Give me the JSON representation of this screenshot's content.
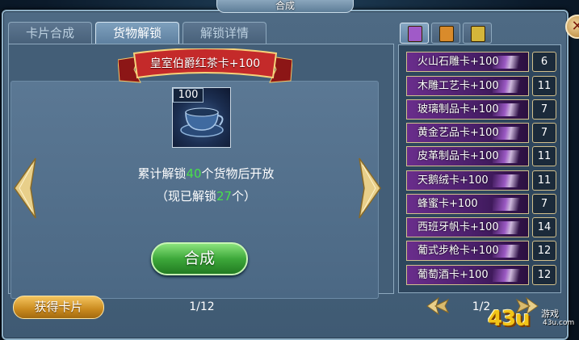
{
  "window": {
    "title": "合成"
  },
  "tabs": [
    {
      "label": "卡片合成",
      "active": false
    },
    {
      "label": "货物解锁",
      "active": true
    },
    {
      "label": "解锁详情",
      "active": false
    }
  ],
  "featured": {
    "name": "皇室伯爵红茶卡+100",
    "badge": "100",
    "unlock_prefix": "累计解锁",
    "unlock_target": "40",
    "unlock_suffix": "个货物后开放",
    "current_prefix": "（现已解锁",
    "current_value": "27",
    "current_suffix": "个）"
  },
  "buttons": {
    "craft": "合成",
    "get_card": "获得卡片"
  },
  "pagination_left": "1/12",
  "pagination_right": "1/2",
  "icon_tabs": [
    {
      "icon": "purple-book-icon",
      "color": "#a05ac8",
      "active": true
    },
    {
      "icon": "orange-book-icon",
      "color": "#d98b2b",
      "active": false
    },
    {
      "icon": "gold-book-icon",
      "color": "#d4b53a",
      "active": false
    }
  ],
  "card_list": [
    {
      "name": "火山石雕卡+100",
      "count": "6"
    },
    {
      "name": "木雕工艺卡+100",
      "count": "11"
    },
    {
      "name": "玻璃制品卡+100",
      "count": "7"
    },
    {
      "name": "黄金艺品卡+100",
      "count": "7"
    },
    {
      "name": "皮革制品卡+100",
      "count": "11"
    },
    {
      "name": "天鹅绒卡+100",
      "count": "11"
    },
    {
      "name": "蜂蜜卡+100",
      "count": "7"
    },
    {
      "name": "西班牙帆卡+100",
      "count": "14"
    },
    {
      "name": "葡式步枪卡+100",
      "count": "12"
    },
    {
      "name": "葡萄酒卡+100",
      "count": "12"
    }
  ],
  "watermark": {
    "logo": "43u",
    "label": "游戏",
    "url": "43u.com"
  }
}
